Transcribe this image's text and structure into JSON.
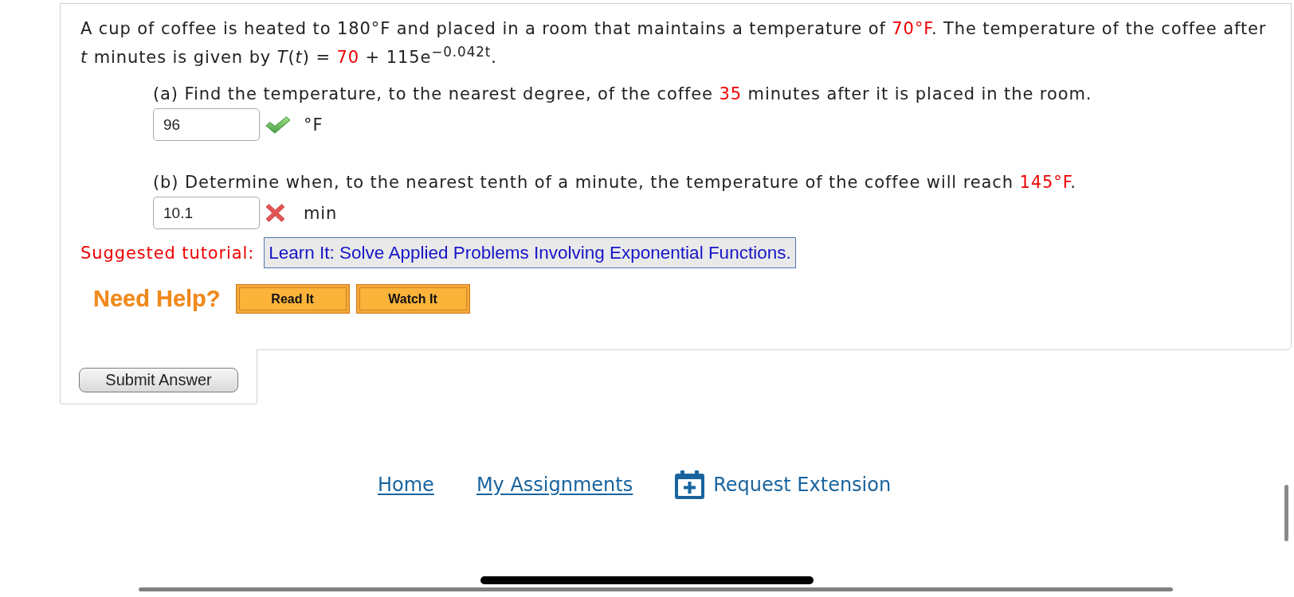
{
  "question": {
    "segments": [
      {
        "text": "A cup of coffee is heated to 180°F and placed in a room that maintains a temperature of ",
        "highlight": false
      },
      {
        "text": "70°F",
        "highlight": true
      },
      {
        "text": ". The temperature of the coffee after *t* minutes is given by  *T*(*t*) = ",
        "highlight": false
      },
      {
        "text": "70",
        "highlight": true
      },
      {
        "text": " + 115e$^{−0.042t}$.",
        "highlight": false
      }
    ]
  },
  "parts": [
    {
      "prompt": [
        {
          "text": "(a) Find the temperature, to the nearest degree, of the coffee ",
          "highlight": false
        },
        {
          "text": "35",
          "highlight": true
        },
        {
          "text": " minutes after it is placed in the room.",
          "highlight": false
        }
      ],
      "answer": {
        "value": "96",
        "correct": true,
        "unit": "°F"
      }
    },
    {
      "prompt": [
        {
          "text": "(b) Determine when, to the nearest tenth of a minute, the temperature of the coffee will reach ",
          "highlight": false
        },
        {
          "text": "145°F",
          "highlight": true
        },
        {
          "text": ".",
          "highlight": false
        }
      ],
      "answer": {
        "value": "10.1",
        "correct": false,
        "unit": "min"
      }
    }
  ],
  "tutorial": {
    "label": "Suggested tutorial:",
    "link": "Learn It: Solve Applied Problems Involving Exponential Functions."
  },
  "help": {
    "label": "Need Help?",
    "buttons": [
      "Read It",
      "Watch It"
    ]
  },
  "submit": {
    "label": "Submit Answer"
  },
  "footer": {
    "links": [
      {
        "label": "Home",
        "kind": "text"
      },
      {
        "label": "My Assignments",
        "kind": "text"
      },
      {
        "label": "Request Extension",
        "kind": "calendar"
      }
    ]
  }
}
